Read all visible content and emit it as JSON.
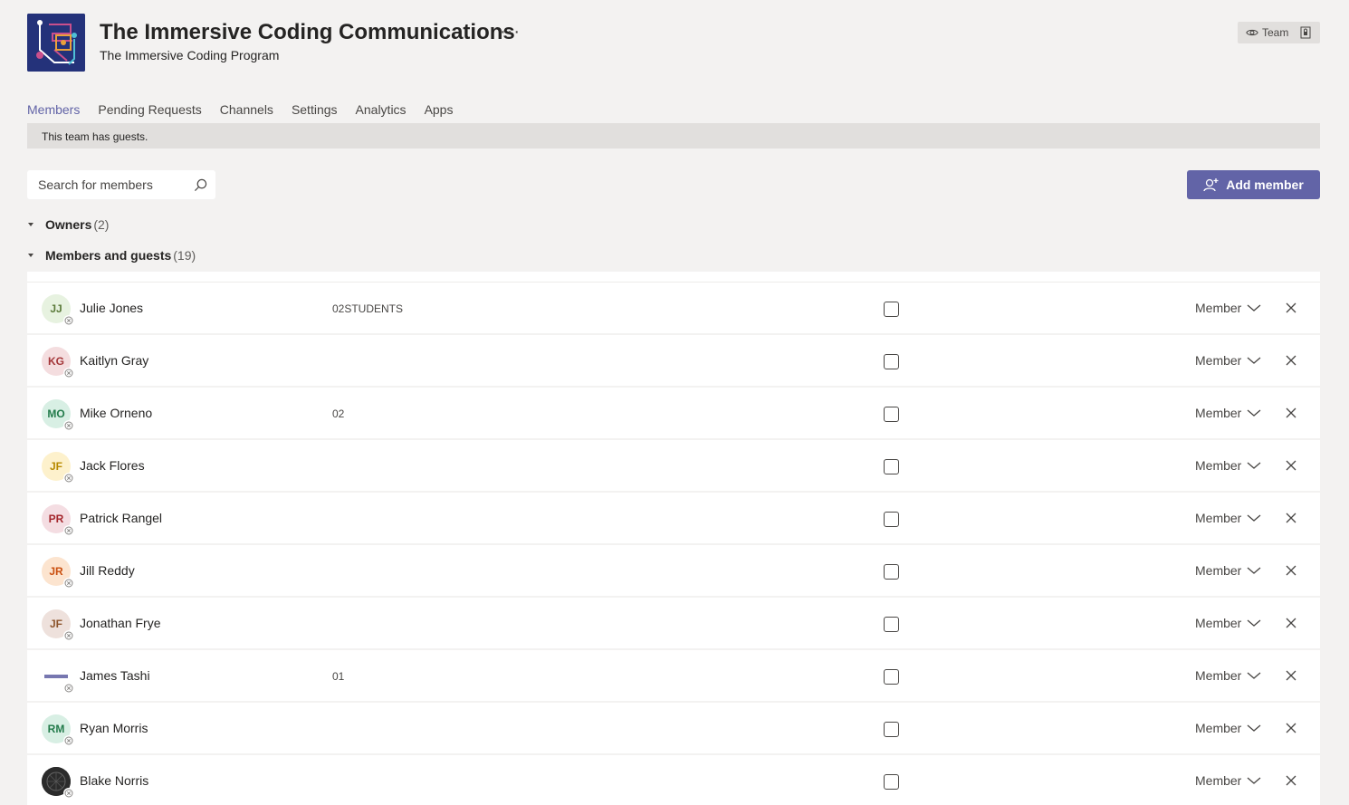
{
  "header": {
    "team_name": "The Immersive Coding Communications",
    "more_label": "···",
    "subtitle": "The Immersive Coding Program",
    "badge_label": "Team"
  },
  "tabs": [
    {
      "label": "Members",
      "active": true
    },
    {
      "label": "Pending Requests"
    },
    {
      "label": "Channels"
    },
    {
      "label": "Settings"
    },
    {
      "label": "Analytics"
    },
    {
      "label": "Apps"
    }
  ],
  "banner": "This team has guests.",
  "search": {
    "placeholder": "Search for members"
  },
  "add_button": "Add member",
  "sections": {
    "owners": {
      "title": "Owners",
      "count": "(2)"
    },
    "members": {
      "title": "Members and guests",
      "count": "(19)"
    }
  },
  "members": [
    {
      "initials": "JJ",
      "name": "Julie Jones",
      "tag": "02STUDENTS",
      "role": "Member",
      "bg": "#e7f2e0",
      "fg": "#5b7a3a"
    },
    {
      "initials": "KG",
      "name": "Kaitlyn Gray",
      "tag": "",
      "role": "Member",
      "bg": "#f4dddf",
      "fg": "#a4373a"
    },
    {
      "initials": "MO",
      "name": "Mike Orneno",
      "tag": "02",
      "role": "Member",
      "bg": "#d8efe4",
      "fg": "#237b4b"
    },
    {
      "initials": "JF",
      "name": "Jack Flores",
      "tag": "",
      "role": "Member",
      "bg": "#fdf1cc",
      "fg": "#b88a00"
    },
    {
      "initials": "PR",
      "name": "Patrick Rangel",
      "tag": "",
      "role": "Member",
      "bg": "#f4dde2",
      "fg": "#a4262c"
    },
    {
      "initials": "JR",
      "name": "Jill Reddy",
      "tag": "",
      "role": "Member",
      "bg": "#fce4cf",
      "fg": "#ca5010"
    },
    {
      "initials": "JF",
      "name": "Jonathan Frye",
      "tag": "",
      "role": "Member",
      "bg": "#eee1dc",
      "fg": "#8e562e"
    },
    {
      "initials": "",
      "name": "James Tashi",
      "tag": "01",
      "role": "Member",
      "bg": "#ffffff",
      "fg": "#3d3d8f"
    },
    {
      "initials": "RM",
      "name": "Ryan Morris",
      "tag": "",
      "role": "Member",
      "bg": "#d8efe4",
      "fg": "#237b4b"
    },
    {
      "initials": "",
      "name": "Blake Norris",
      "tag": "",
      "role": "Member",
      "bg": "#2b2b2b",
      "fg": "#ffffff"
    }
  ],
  "colors": {
    "accent": "#6264a7",
    "background": "#f3f2f1"
  }
}
